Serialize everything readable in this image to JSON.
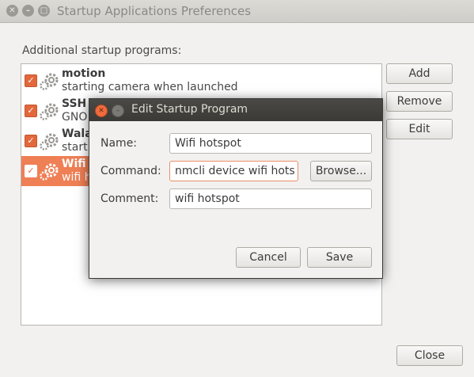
{
  "window": {
    "title": "Startup Applications Preferences",
    "section_label": "Additional startup programs:",
    "buttons": {
      "add": "Add",
      "remove": "Remove",
      "edit": "Edit",
      "close": "Close"
    },
    "programs": [
      {
        "name": "motion",
        "description": "starting camera when launched",
        "checked": true
      },
      {
        "name": "SSH",
        "description": "GNO",
        "checked": true
      },
      {
        "name": "Wala",
        "description": "start",
        "checked": true
      },
      {
        "name": "Wifi",
        "description": "wifi h",
        "checked": true,
        "selected": true
      }
    ]
  },
  "dialog": {
    "title": "Edit Startup Program",
    "name_label": "Name:",
    "name_value": "Wifi hotspot",
    "command_label": "Command:",
    "command_value": "nmcli device wifi hots",
    "browse_label": "Browse...",
    "comment_label": "Comment:",
    "comment_value": "wifi hotspot",
    "cancel_label": "Cancel",
    "save_label": "Save"
  },
  "colors": {
    "accent": "#ef7f55",
    "close_button": "#f06b3e",
    "dialog_titlebar": "#3b3a36"
  },
  "icons": {
    "close": "close-icon",
    "minimize": "minimize-icon",
    "program": "gears-icon",
    "check": "checkmark-icon"
  }
}
